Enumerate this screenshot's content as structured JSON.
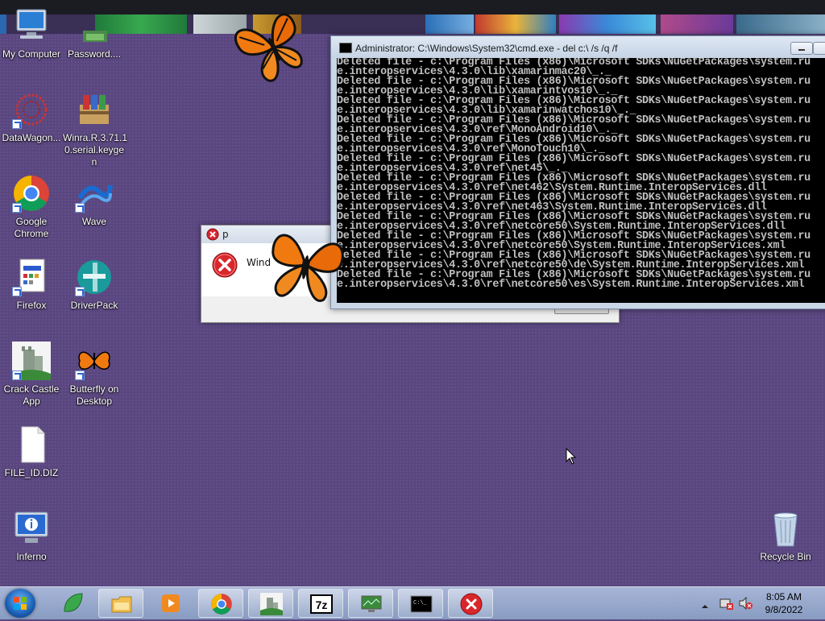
{
  "desktop": {
    "icons": [
      {
        "id": "my-computer",
        "label": "My Computer"
      },
      {
        "id": "password",
        "label": "Password...."
      },
      {
        "id": "datawagon",
        "label": "DataWagon..."
      },
      {
        "id": "winra",
        "label": "Winra.R.3.71.1\n0.serial.keyge\nn"
      },
      {
        "id": "chrome",
        "label": "Google\nChrome"
      },
      {
        "id": "wave",
        "label": "Wave"
      },
      {
        "id": "firefox",
        "label": "Firefox"
      },
      {
        "id": "driverpack",
        "label": "DriverPack"
      },
      {
        "id": "crack-castle",
        "label": "Crack Castle\nApp"
      },
      {
        "id": "butterfly",
        "label": "Butterfly on\nDesktop"
      },
      {
        "id": "file-id",
        "label": "FILE_ID.DIZ"
      },
      {
        "id": "inferno",
        "label": "Inferno"
      },
      {
        "id": "recycle-bin",
        "label": "Recycle Bin"
      }
    ]
  },
  "dialog": {
    "title": "p",
    "message": "Wind"
  },
  "cmd": {
    "title": "Administrator: C:\\Windows\\System32\\cmd.exe - del  c:\\ /s /q /f",
    "lines": [
      "Deleted file - c:\\Program Files (x86)\\Microsoft SDKs\\NuGetPackages\\system.ru",
      "e.interopservices\\4.3.0\\lib\\xamarinmac20\\_._",
      "Deleted file - c:\\Program Files (x86)\\Microsoft SDKs\\NuGetPackages\\system.ru",
      "e.interopservices\\4.3.0\\lib\\xamarintvos10\\_._",
      "Deleted file - c:\\Program Files (x86)\\Microsoft SDKs\\NuGetPackages\\system.ru",
      "e.interopservices\\4.3.0\\lib\\xamarinwatchos10\\_._",
      "Deleted file - c:\\Program Files (x86)\\Microsoft SDKs\\NuGetPackages\\system.ru",
      "e.interopservices\\4.3.0\\ref\\MonoAndroid10\\_._",
      "Deleted file - c:\\Program Files (x86)\\Microsoft SDKs\\NuGetPackages\\system.ru",
      "e.interopservices\\4.3.0\\ref\\MonoTouch10\\_._",
      "Deleted file - c:\\Program Files (x86)\\Microsoft SDKs\\NuGetPackages\\system.ru",
      "e.interopservices\\4.3.0\\ref\\net45\\_._",
      "Deleted file - c:\\Program Files (x86)\\Microsoft SDKs\\NuGetPackages\\system.ru",
      "e.interopservices\\4.3.0\\ref\\net462\\System.Runtime.InteropServices.dll",
      "Deleted file - c:\\Program Files (x86)\\Microsoft SDKs\\NuGetPackages\\system.ru",
      "e.interopservices\\4.3.0\\ref\\net463\\System.Runtime.InteropServices.dll",
      "Deleted file - c:\\Program Files (x86)\\Microsoft SDKs\\NuGetPackages\\system.ru",
      "e.interopservices\\4.3.0\\ref\\netcore50\\System.Runtime.InteropServices.dll",
      "Deleted file - c:\\Program Files (x86)\\Microsoft SDKs\\NuGetPackages\\system.ru",
      "e.interopservices\\4.3.0\\ref\\netcore50\\System.Runtime.InteropServices.xml",
      "Deleted file - c:\\Program Files (x86)\\Microsoft SDKs\\NuGetPackages\\system.ru",
      "e.interopservices\\4.3.0\\ref\\netcore50\\de\\System.Runtime.InteropServices.xml",
      "Deleted file - c:\\Program Files (x86)\\Microsoft SDKs\\NuGetPackages\\system.ru",
      "e.interopservices\\4.3.0\\ref\\netcore50\\es\\System.Runtime.InteropServices.xml"
    ]
  },
  "taskbar": {
    "apps": [
      {
        "id": "leaf",
        "icon": "leaf-icon"
      },
      {
        "id": "explorer",
        "icon": "folder-icon"
      },
      {
        "id": "media",
        "icon": "media-player-icon"
      },
      {
        "id": "chrome",
        "icon": "chrome-icon"
      },
      {
        "id": "castle",
        "icon": "castle-icon"
      },
      {
        "id": "7z",
        "icon": "7zip-icon",
        "text": "7z"
      },
      {
        "id": "monitor",
        "icon": "monitor-icon"
      },
      {
        "id": "cmd",
        "icon": "cmd-icon",
        "text": "C:\\_"
      },
      {
        "id": "error",
        "icon": "error-icon"
      }
    ],
    "clock": {
      "time": "8:05 AM",
      "date": "9/8/2022"
    }
  },
  "colors": {
    "desktop": "#5a4680",
    "console_bg": "#000000",
    "console_text": "#c0c0c0",
    "error_red": "#d9262b"
  }
}
